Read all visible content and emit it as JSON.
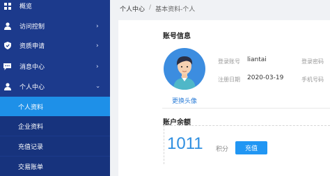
{
  "sidebar": {
    "menu": [
      {
        "icon": "dashboard-icon",
        "label": "概览",
        "has_chevron": false
      },
      {
        "icon": "user-icon",
        "label": "访问控制",
        "has_chevron": true
      },
      {
        "icon": "shield-icon",
        "label": "资质申请",
        "has_chevron": true
      },
      {
        "icon": "message-icon",
        "label": "消息中心",
        "has_chevron": true
      },
      {
        "icon": "user-icon",
        "label": "个人中心",
        "has_chevron": true,
        "expanded": true
      }
    ],
    "submenu": [
      {
        "label": "个人资料",
        "active": true
      },
      {
        "label": "企业资料",
        "active": false
      },
      {
        "label": "充值记录",
        "active": false
      },
      {
        "label": "交易账单",
        "active": false
      }
    ]
  },
  "breadcrumb": {
    "root": "个人中心",
    "sep": "/",
    "current": "基本资料-个人"
  },
  "account": {
    "title": "账号信息",
    "change_avatar": "更换头像",
    "login_account_label": "登录账号",
    "login_account_value": "liantai",
    "register_date_label": "注册日期",
    "register_date_value": "2020-03-19",
    "login_password_label": "登录密码",
    "mobile_label": "手机号码"
  },
  "balance": {
    "title": "账户余额",
    "value": "1011",
    "unit": "积分",
    "recharge_label": "充值"
  },
  "colors": {
    "sidebar": "#1c3a8c",
    "active": "#1e90e8",
    "accent": "#2196f3"
  }
}
